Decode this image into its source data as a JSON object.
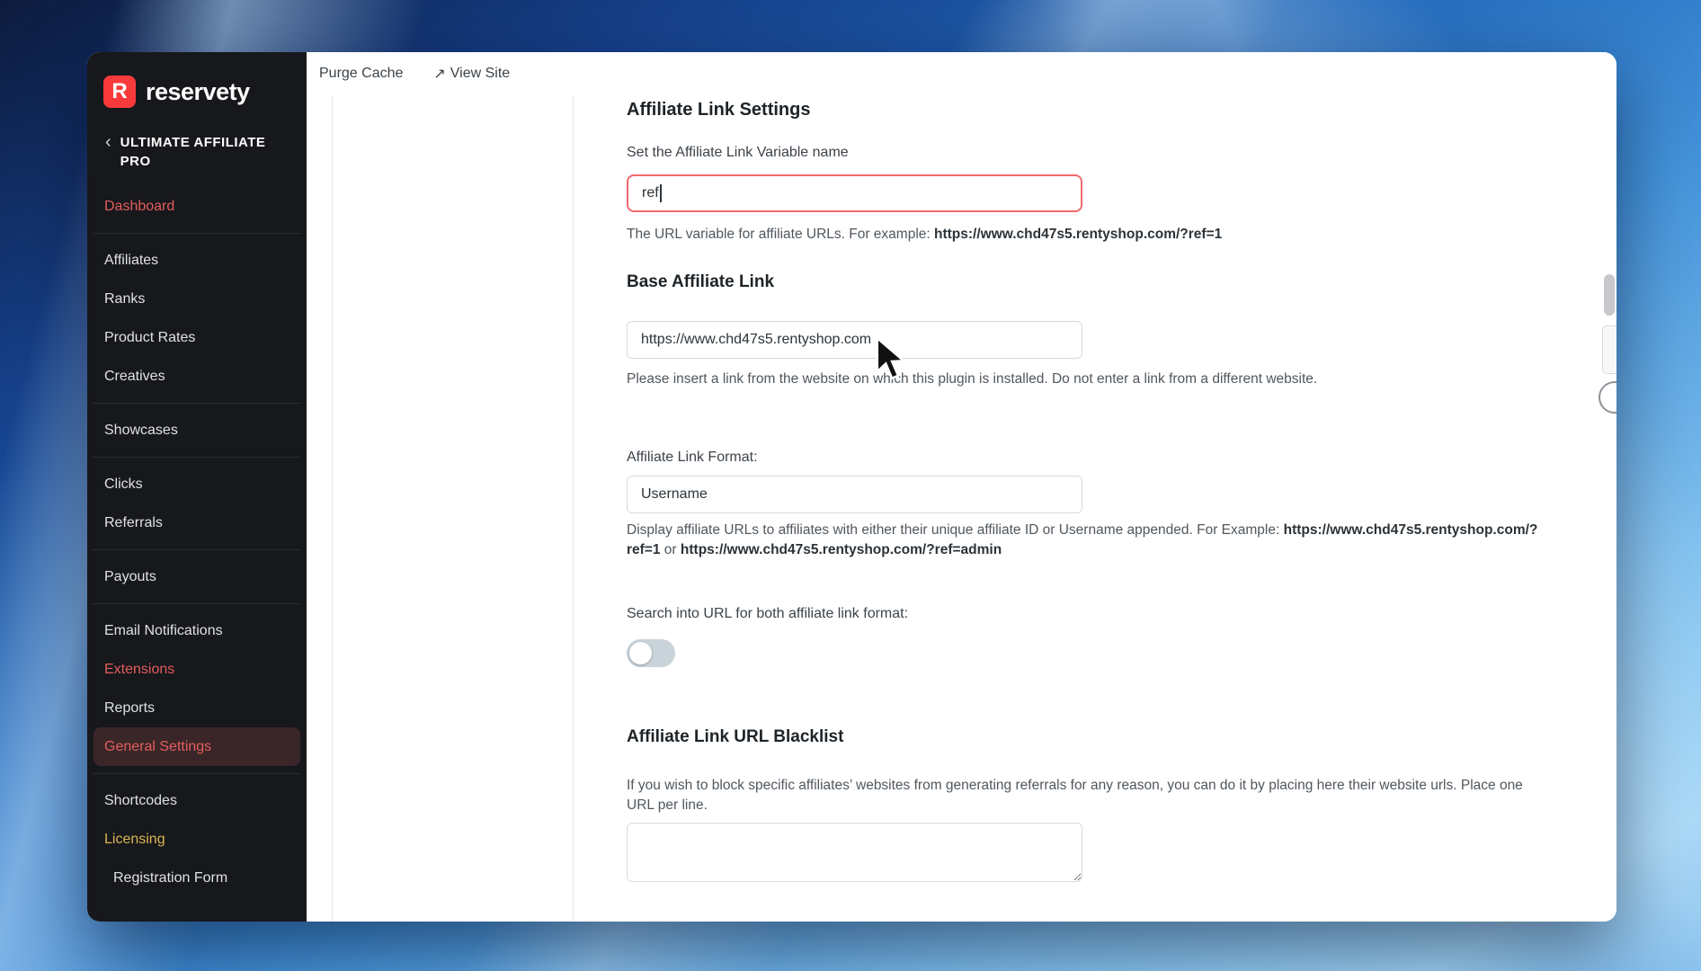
{
  "topbar": {
    "purge_cache": "Purge Cache",
    "view_site": "View Site",
    "view_site_icon": "↗"
  },
  "sidebar": {
    "brand": "reservety",
    "brand_initial": "R",
    "collapse_icon": "‹",
    "plugin_title": "ULTIMATE AFFILIATE PRO",
    "items": [
      {
        "label": "Dashboard",
        "state": "highlight-red"
      },
      {
        "label": "Affiliates",
        "state": "default"
      },
      {
        "label": "Ranks",
        "state": "default"
      },
      {
        "label": "Product Rates",
        "state": "default"
      },
      {
        "label": "Creatives",
        "state": "default"
      },
      {
        "label": "Showcases",
        "state": "default"
      },
      {
        "label": "Clicks",
        "state": "default"
      },
      {
        "label": "Referrals",
        "state": "default"
      },
      {
        "label": "Payouts",
        "state": "default"
      },
      {
        "label": "Email Notifications",
        "state": "default"
      },
      {
        "label": "Extensions",
        "state": "highlight-red"
      },
      {
        "label": "Reports",
        "state": "default"
      },
      {
        "label": "General Settings",
        "state": "active"
      },
      {
        "label": "Shortcodes",
        "state": "default"
      },
      {
        "label": "Licensing",
        "state": "highlight-yellow"
      },
      {
        "label": "Registration Form",
        "state": "child"
      }
    ]
  },
  "main": {
    "title": "Affiliate Link Settings",
    "variable_name": {
      "label": "Set the Affiliate Link Variable name",
      "value": "ref",
      "help_prefix": "The URL variable for affiliate URLs. For example: ",
      "help_url": "https://www.chd47s5.rentyshop.com/?ref=1"
    },
    "base_link": {
      "title": "Base Affiliate Link",
      "value": "https://www.chd47s5.rentyshop.com",
      "help": "Please insert a link from the website on which this plugin is installed. Do not enter a link from a different website."
    },
    "link_format": {
      "label": "Affiliate Link Format:",
      "value": "Username",
      "help_prefix": "Display affiliate URLs to affiliates with either their unique affiliate ID or Username appended. For Example: ",
      "help_url_1": "https://www.chd47s5.rentyshop.com/?ref=1",
      "help_conjunction": " or ",
      "help_url_2": "https://www.chd47s5.rentyshop.com/?ref=admin"
    },
    "search_url": {
      "label": "Search into URL for both affiliate link format:",
      "toggle_state": "off"
    },
    "blacklist": {
      "title": "Affiliate Link URL Blacklist",
      "help": "If you wish to block specific affiliates’ websites from generating referrals for any reason, you can do it by placing here their website urls. Place one URL per line.",
      "value": ""
    }
  }
}
